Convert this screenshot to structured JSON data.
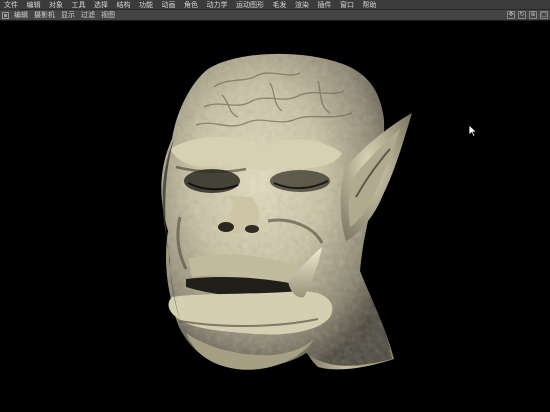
{
  "menubar": {
    "items": [
      "文件",
      "编辑",
      "对象",
      "工具",
      "选择",
      "结构",
      "功能",
      "动画",
      "角色",
      "动力学",
      "运动图形",
      "毛发",
      "渲染",
      "插件",
      "窗口",
      "帮助"
    ]
  },
  "viewbar": {
    "items": [
      "编辑",
      "摄影机",
      "显示",
      "过滤",
      "视图"
    ],
    "right_icons": [
      "move-view-icon",
      "rotate-view-icon",
      "zoom-view-icon",
      "maximize-view-icon"
    ]
  },
  "viewport": {
    "subject": "sculpted-orc-head",
    "background_color": "#000000",
    "model_color": "#cfc8aa"
  }
}
